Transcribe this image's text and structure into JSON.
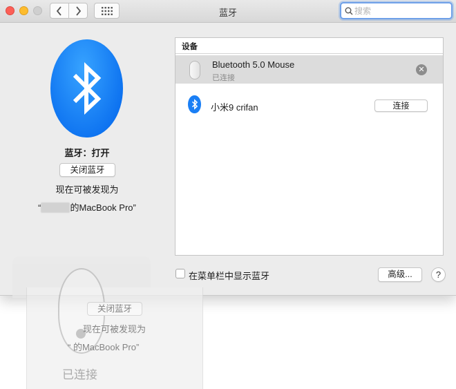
{
  "window": {
    "title": "蓝牙",
    "search": {
      "placeholder": "搜索",
      "value": ""
    }
  },
  "left_panel": {
    "status": "蓝牙：打开",
    "turn_off_button": "关闭蓝牙",
    "discoverable_text": "现在可被发现为",
    "device_name_prefix": "“",
    "device_name_suffix": "的MacBook Pro”"
  },
  "devices_panel": {
    "header": "设备",
    "devices": [
      {
        "name": "Bluetooth 5.0 Mouse",
        "status": "已连接",
        "icon": "mouse-icon"
      },
      {
        "name": "小米9 crifan",
        "action": "连接",
        "icon": "bluetooth-icon"
      }
    ]
  },
  "footer": {
    "menubar_checkbox_label": "在菜单栏中显示蓝牙",
    "menubar_checked": false,
    "advanced_button": "高级...",
    "help_button": "?"
  },
  "ghost_overlay": {
    "turn_off_button": "关闭蓝牙",
    "discoverable_text": "现在可被发现为",
    "device_name": "“       的MacBook Pro”",
    "connected_label": "已连接"
  },
  "colors": {
    "bluetooth_blue": "#0d72f0",
    "close": "#fc5f57",
    "minimize": "#fdbc2e",
    "search_focus": "#6ea0e8"
  }
}
